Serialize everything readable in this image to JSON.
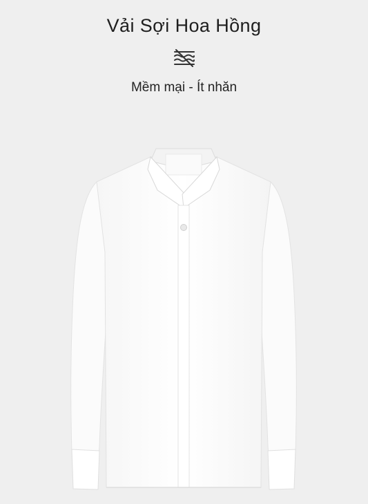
{
  "product": {
    "fabric_title": "Vải Sợi Hoa Hồng",
    "fabric_icon": "no-wrinkle-icon",
    "features": "Mềm mại - Ít nhăn",
    "image": "white-long-sleeve-shirt"
  },
  "colors": {
    "background": "#efefef",
    "shirt": "#ffffff",
    "text": "#222222"
  }
}
